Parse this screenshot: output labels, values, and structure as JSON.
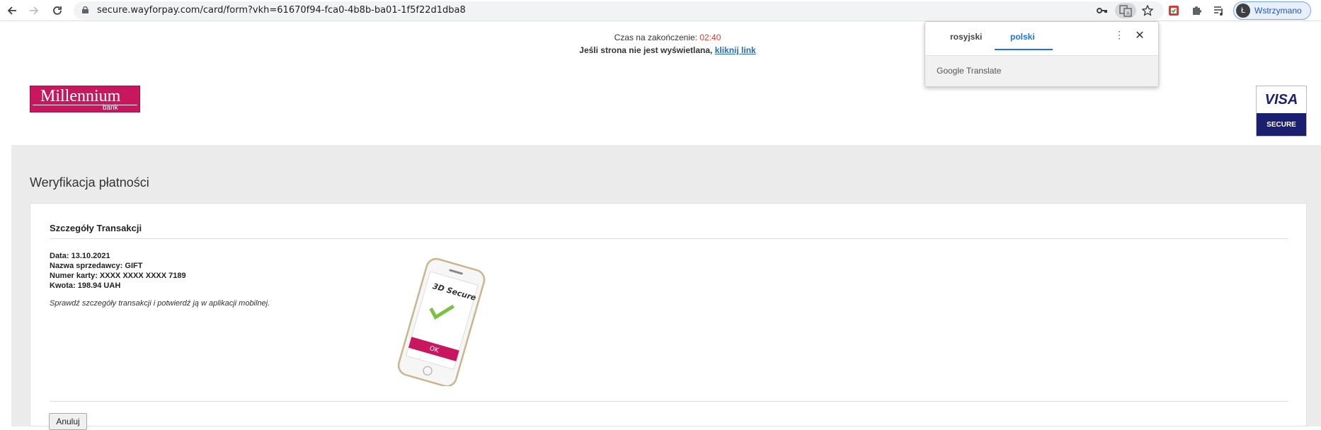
{
  "browser": {
    "url": "secure.wayforpay.com/card/form?vkh=61670f94-fca0-4b8b-ba01-1f5f22d1dba8",
    "profile_initial": "Ł",
    "profile_status": "Wstrzymano"
  },
  "header": {
    "timer_label": "Czas na zakończenie:",
    "timer_value": "02:40",
    "notice_text": "Jeśli strona nie jest wyświetlana,",
    "notice_link": "kliknij link"
  },
  "logos": {
    "bank_name": "Millennium",
    "bank_sub": "bank",
    "visa_name": "VISA",
    "visa_sub": "SECURE"
  },
  "page": {
    "title": "Weryfikacja płatności",
    "panel_title": "Szczegóły Transakcji",
    "details": [
      {
        "label": "Data:",
        "value": "13.10.2021"
      },
      {
        "label": "Nazwa sprzedawcy:",
        "value": "GIFT"
      },
      {
        "label": "Numer karty:",
        "value": "XXXX XXXX XXXX 7189"
      },
      {
        "label": "Kwota:",
        "value": "198.94 UAH"
      }
    ],
    "hint": "Sprawdź szczegóły transakcji i potwierdź ją w aplikacji mobilnej.",
    "phone_title": "3D Secure",
    "phone_ok": "OK",
    "cancel_label": "Anuluj"
  },
  "translate_popup": {
    "source_lang": "rosyjski",
    "target_lang": "polski",
    "brand": "Google Translate"
  },
  "colors": {
    "brand": "#c8175f",
    "timer": "#e23d2e",
    "link": "#2a6bb0",
    "visa_blue": "#1a1f71"
  }
}
